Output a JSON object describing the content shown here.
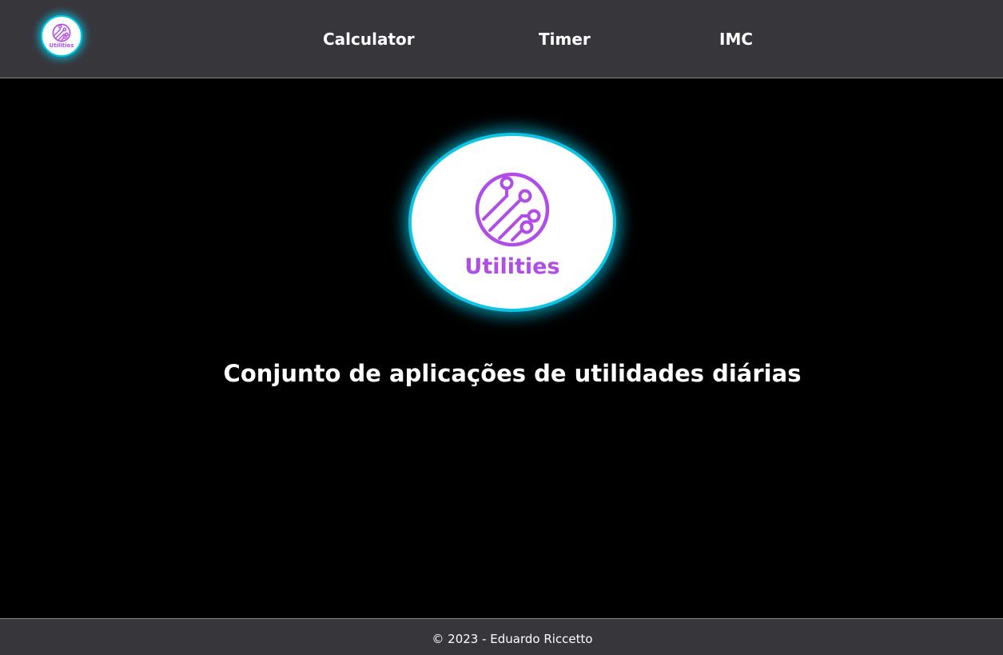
{
  "header": {
    "logo_text": "Utilities",
    "nav": {
      "calculator": "Calculator",
      "timer": "Timer",
      "imc": "IMC"
    }
  },
  "main": {
    "logo_text": "Utilities",
    "headline": "Conjunto de aplicações de utilidades diárias"
  },
  "footer": {
    "text": "© 2023 - Eduardo Riccetto"
  },
  "colors": {
    "header_bg": "#37363b",
    "page_bg": "#000000",
    "accent_glow": "#00c8e8",
    "brand_purple": "#b04de6"
  }
}
